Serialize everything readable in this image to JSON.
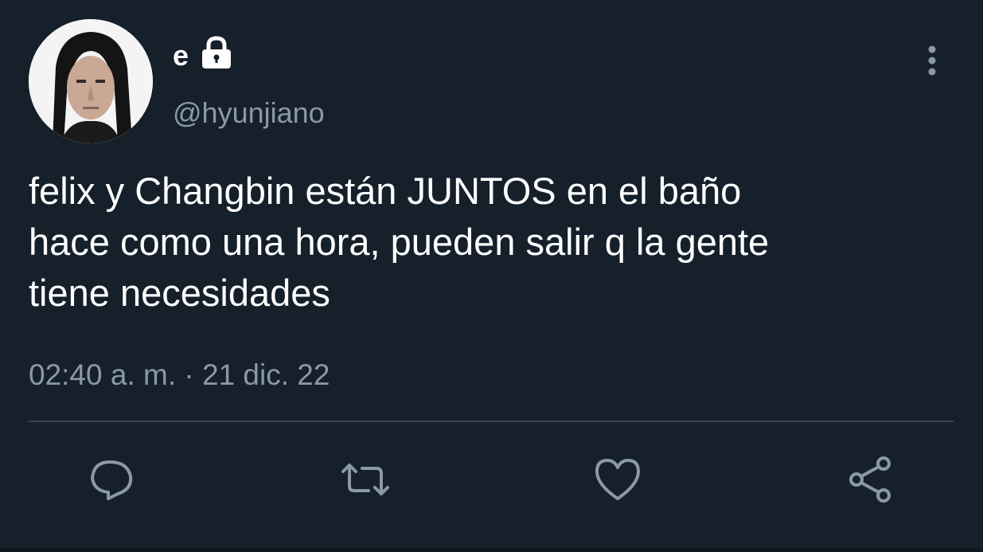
{
  "author": {
    "display_name": "e",
    "handle": "@hyunjiano",
    "protected_icon": "lock-icon"
  },
  "tweet": {
    "text": "felix y Changbin están JUNTOS en el baño\nhace como una hora, pueden salir q la gente\ntiene necesidades",
    "timestamp": "02:40 a. m. · 21 dic. 22"
  },
  "actions": [
    {
      "name": "reply",
      "icon": "comment-icon"
    },
    {
      "name": "retweet",
      "icon": "retweet-icon"
    },
    {
      "name": "like",
      "icon": "heart-icon"
    },
    {
      "name": "share",
      "icon": "share-icon"
    }
  ],
  "colors": {
    "background": "#15202b",
    "primary_text": "#ffffff",
    "secondary_text": "#8b98a5",
    "icon": "#8b98a5",
    "divider": "#38444d"
  }
}
